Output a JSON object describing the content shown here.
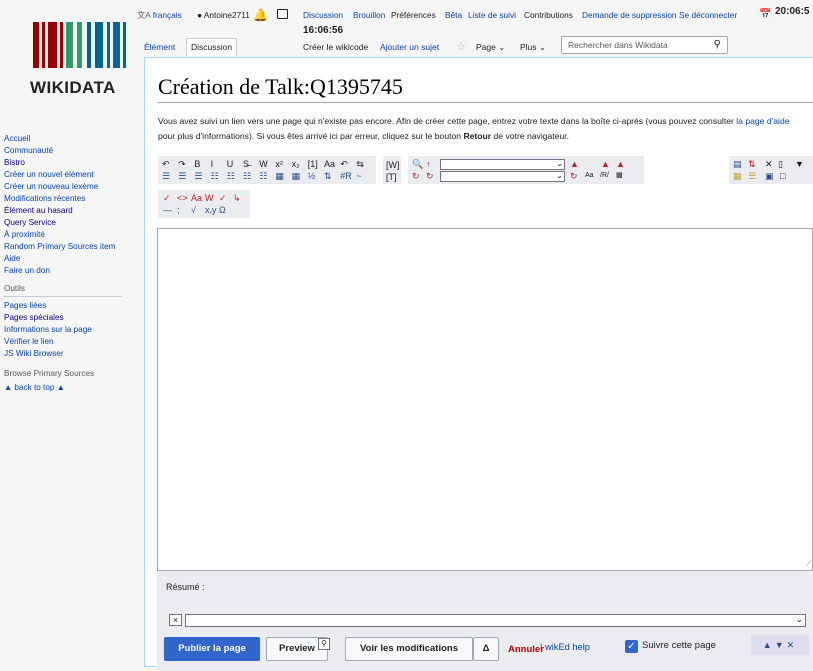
{
  "logo": {
    "wordmark": "WIKIDATA",
    "bar_colors": [
      "#990000",
      "#339966",
      "#006699"
    ]
  },
  "personal": {
    "language": "français",
    "user": "Antoine2711",
    "discussion": "Discussion",
    "sandbox": "Brouillon",
    "preferences": "Préférences",
    "beta": "Bêta",
    "watchlist": "Liste de suivi",
    "contributions": "Contributions",
    "deletion_request": "Demande de suppression",
    "logout": "Se déconnecter",
    "clock": "20:06:5",
    "clock_local": "16:06:56"
  },
  "tabs": {
    "item": "Élément",
    "discussion": "Discussion",
    "create_wikicode": "Créer le wikicode",
    "add_topic": "Ajouter un sujet",
    "page": "Page",
    "more": "Plus",
    "search_placeholder": "Rechercher dans Wikidata"
  },
  "sidebar": {
    "nav": [
      {
        "label": "Accueil",
        "style": "link"
      },
      {
        "label": "Communauté",
        "style": "link"
      },
      {
        "label": "Bistro",
        "style": "vis"
      },
      {
        "label": "Créer un nouvel élément",
        "style": "link"
      },
      {
        "label": "Créer un nouveau lexème",
        "style": "link"
      },
      {
        "label": "Modifications récentes",
        "style": "link"
      },
      {
        "label": "Élément au hasard",
        "style": "vis"
      },
      {
        "label": "Query Service",
        "style": "vis"
      },
      {
        "label": "À proximité",
        "style": "link"
      },
      {
        "label": "Random Primary Sources item",
        "style": "link"
      },
      {
        "label": "Aide",
        "style": "link"
      },
      {
        "label": "Faire un don",
        "style": "link"
      }
    ],
    "tools_heading": "Outils",
    "tools": [
      {
        "label": "Pages liées",
        "style": "link"
      },
      {
        "label": "Pages spéciales",
        "style": "vis"
      },
      {
        "label": "Informations sur la page",
        "style": "link"
      },
      {
        "label": "Vérifier le lien",
        "style": "link"
      },
      {
        "label": "JS Wiki Browser",
        "style": "link"
      }
    ],
    "sources_heading": "Browse Primary Sources",
    "back_to_top": "▲ back to top ▲"
  },
  "content": {
    "title": "Création de Talk:Q1395745",
    "intro_1": "Vous avez suivi un lien vers une page qui n'existe pas encore. Afin de créer cette page, entrez votre texte dans la boîte ci-après (vous pouvez consulter ",
    "intro_link": "la page d'aide",
    "intro_2": " pour plus d'informations). Si vous êtes arrivé ici par erreur, cliquez sur le bouton ",
    "intro_bold": "Retour",
    "intro_3": " de votre navigateur."
  },
  "toolbar": {
    "row1": [
      "↶",
      "↷",
      "B",
      "I",
      "U",
      "S̶",
      "W",
      "x²",
      "x₂",
      "[1]",
      "Aa",
      "↶",
      "⇆"
    ],
    "row2": [
      "☰",
      "☰",
      "☰",
      "☷",
      "☷",
      "☷",
      "☷",
      "▦",
      "▦",
      "½",
      "⇅",
      "#R",
      "~"
    ],
    "row3": [
      "✓",
      "<>",
      "Aa",
      "W",
      "✓",
      "↳"
    ],
    "row4": [
      "—",
      ";",
      "√",
      "x,y",
      "Ω"
    ],
    "wiki_buttons": [
      "[W]",
      "[T]"
    ]
  },
  "form": {
    "summary_label": "Résumé :",
    "clear": "×",
    "publish": "Publier la page",
    "preview": "Preview",
    "show_changes": "Voir les modifications",
    "delta": "Δ",
    "cancel": "Annuler",
    "separator": "|",
    "wikied_help": "wikEd help",
    "watch": "Suivre cette page",
    "watch_checked": true
  }
}
